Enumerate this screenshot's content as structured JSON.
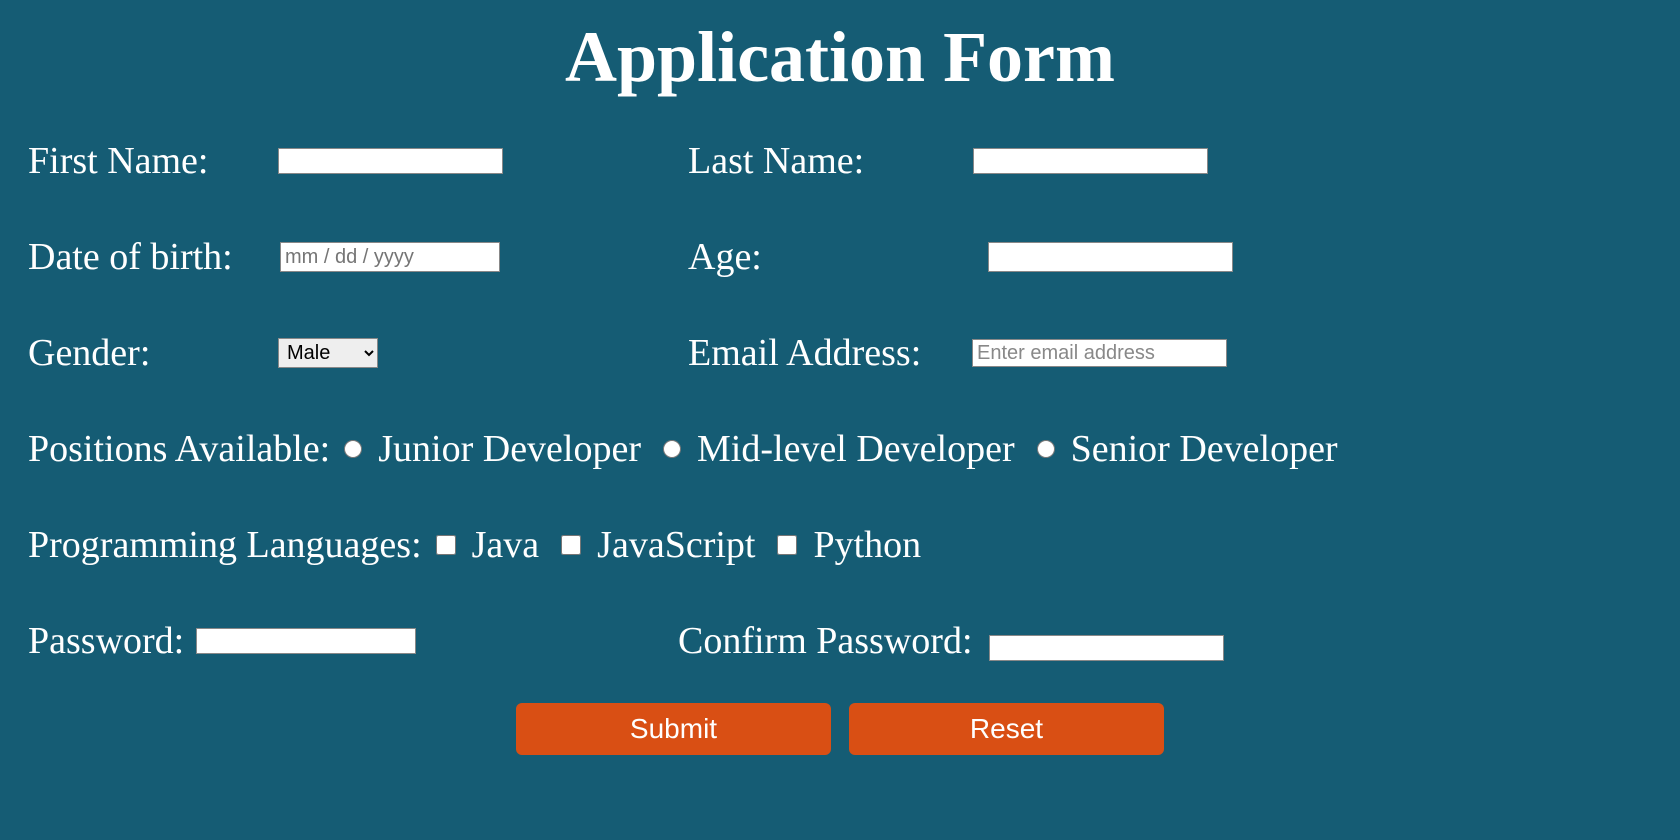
{
  "title": "Application Form",
  "labels": {
    "first_name": "First Name:",
    "last_name": "Last Name:",
    "dob": "Date of birth:",
    "age": "Age:",
    "gender": "Gender:",
    "email": "Email Address:",
    "positions": "Positions Available:",
    "languages": "Programming Languages:",
    "password": "Password:",
    "confirm_password": "Confirm Password:"
  },
  "fields": {
    "first_name": "",
    "last_name": "",
    "dob_placeholder": "mm / dd / yyyy",
    "age": "",
    "gender_selected": "Male",
    "gender_options": [
      "Male"
    ],
    "email": "",
    "email_placeholder": "Enter email address",
    "password": "",
    "confirm_password": ""
  },
  "positions": [
    {
      "label": "Junior Developer"
    },
    {
      "label": "Mid-level Developer"
    },
    {
      "label": "Senior Developer"
    }
  ],
  "languages": [
    {
      "label": "Java"
    },
    {
      "label": "JavaScript"
    },
    {
      "label": "Python"
    }
  ],
  "buttons": {
    "submit": "Submit",
    "reset": "Reset"
  }
}
